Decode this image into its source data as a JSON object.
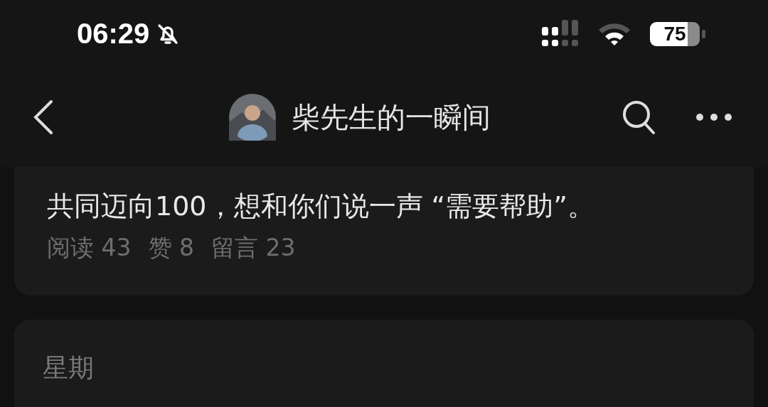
{
  "status_bar": {
    "time": "06:29",
    "battery": "75"
  },
  "nav_bar": {
    "title": "柴先生的一瞬间"
  },
  "post": {
    "text": "共同迈向100，想和你们说一声 “需要帮助”。",
    "stats": [
      {
        "label": "阅读",
        "value": "43"
      },
      {
        "label": "赞",
        "value": "8"
      },
      {
        "label": "留言",
        "value": "23"
      }
    ]
  },
  "next_card": {
    "heading": "星期"
  }
}
